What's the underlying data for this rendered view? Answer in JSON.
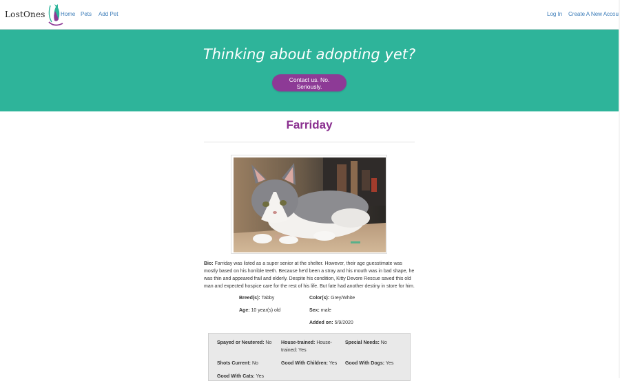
{
  "navbar": {
    "brand": "LostOnes",
    "links": [
      "Home",
      "Pets",
      "Add Pet"
    ],
    "right_links": [
      "Log In",
      "Create A New Account"
    ]
  },
  "hero": {
    "title": "Thinking about adopting yet?",
    "button_label": "Contact us. No. Seriously."
  },
  "pet": {
    "name": "Farriday",
    "bio_label": "Bio:",
    "bio_text": "Farriday was listed as a super senior at the shelter. However, their age guesstimate was mostly based on his horrible teeth. Because he'd been a stray and his mouth was in bad shape, he was thin and appeared frail and elderly. Despite his condition, Kitty Devore Rescue saved this old man and expected hospice care for the rest of his life. But fate had another destiny in store for him.",
    "breed_label": "Breed(s):",
    "breed": "Tabby",
    "color_label": "Color(s):",
    "color": "Grey/White",
    "age_label": "Age:",
    "age": "10 year(s) old",
    "sex_label": "Sex:",
    "sex": "male",
    "added_label": "Added on:",
    "added": "5/9/2020"
  },
  "details": {
    "spayed_label": "Spayed or Neutered:",
    "spayed": "No",
    "housetrained_label": "House-trained:",
    "housetrained": "House-trained: Yes",
    "special_label": "Special Needs:",
    "special": "No",
    "shots_label": "Shots Current:",
    "shots": "No",
    "children_label": "Good With Children:",
    "children": "Yes",
    "dogs_label": "Good With Dogs:",
    "dogs": "Yes",
    "cats_label": "Good With Cats:",
    "cats": "Yes"
  },
  "colors": {
    "hero": "#2eb49a",
    "accent_purple": "#8d3a96",
    "link_blue": "#3a7bb8"
  }
}
